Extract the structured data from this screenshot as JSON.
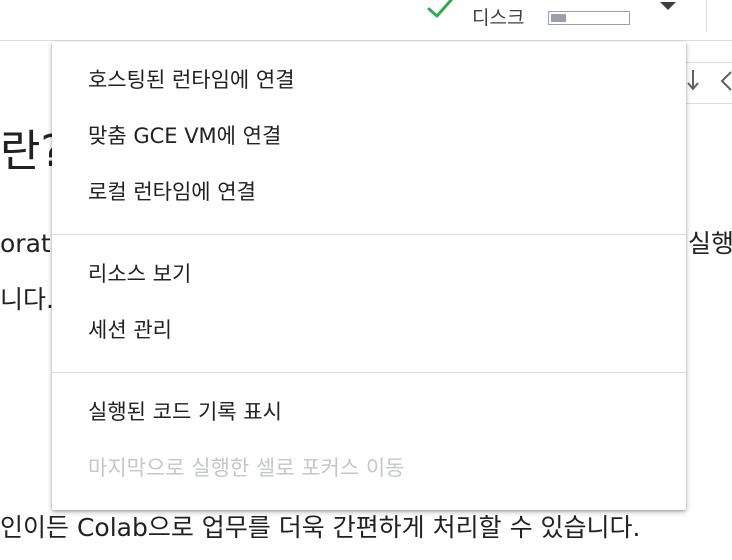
{
  "topbar": {
    "status_icon": "check-icon",
    "status_color": "#34a853",
    "disk_label": "디스크",
    "disk_usage_fraction": 0.2,
    "menu_caret_icon": "caret-down-icon"
  },
  "background": {
    "heading_fragment": "란?",
    "para1_left_fragment": "orato",
    "para1_right_fragment": "실행하",
    "para2_left_fragment": "니다.",
    "bottom_line": "인이든 Colab으로 업무를 더욱 간편하게 처리할 수 있습니다."
  },
  "menu": {
    "groups": [
      {
        "items": [
          {
            "label": "호스팅된 런타임에 연결",
            "enabled": true
          },
          {
            "label": "맞춤 GCE VM에 연결",
            "enabled": true
          },
          {
            "label": "로컬 런타임에 연결",
            "enabled": true
          }
        ]
      },
      {
        "items": [
          {
            "label": "리소스 보기",
            "enabled": true
          },
          {
            "label": "세션 관리",
            "enabled": true
          }
        ]
      },
      {
        "items": [
          {
            "label": "실행된 코드 기록 표시",
            "enabled": true
          },
          {
            "label": "마지막으로 실행한 셀로 포커스 이동",
            "enabled": false
          }
        ]
      }
    ]
  }
}
